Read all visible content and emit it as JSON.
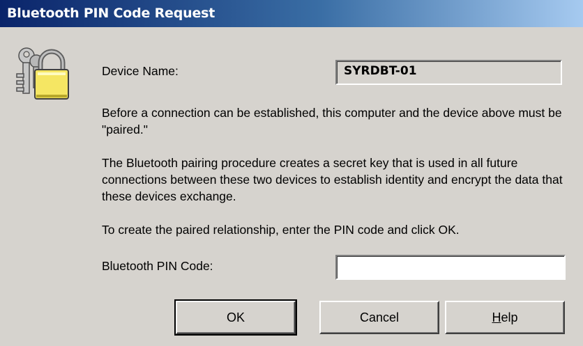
{
  "window": {
    "title": "Bluetooth PIN Code Request"
  },
  "icon": "keys-padlock-icon",
  "device": {
    "label": "Device Name:",
    "value": "SYRDBT-01"
  },
  "paragraphs": {
    "p1": "Before a connection can be established, this computer and the device above must be \"paired.\"",
    "p2": "The Bluetooth pairing procedure creates a secret key that is used in all future connections between these two devices to establish identity and encrypt the data that these devices exchange.",
    "p3": "To create the paired relationship, enter the PIN code and click OK."
  },
  "pin": {
    "label": "Bluetooth PIN Code:",
    "value": ""
  },
  "buttons": {
    "ok": "OK",
    "cancel": "Cancel",
    "help": "Help"
  },
  "colors": {
    "title_start": "#0a246a",
    "title_end": "#a6caf0",
    "dialog_bg": "#d6d3ce",
    "lock": "#f5e663"
  }
}
